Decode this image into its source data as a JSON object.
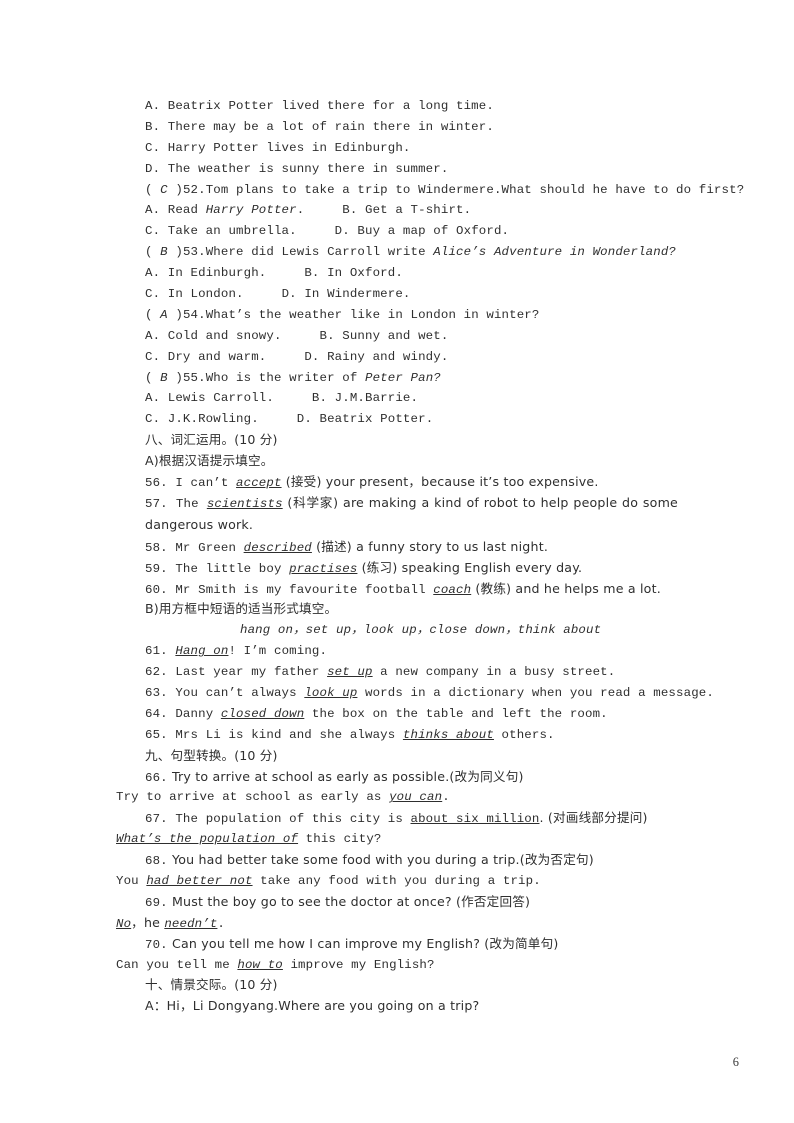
{
  "document": {
    "type": "english-exam-worksheet",
    "page_number": "6",
    "text_color": "#2e2e2e",
    "background": "#ffffff"
  },
  "reading_section": {
    "q51_options": [
      "A. Beatrix Potter lived there for a long time.",
      "B. There may be a lot of rain there in winter.",
      "C. Harry Potter lives in Edinburgh.",
      "D. The weather is sunny there in summer."
    ],
    "questions": [
      {
        "answer": "C",
        "number": "52.",
        "stem": "Tom plans to take a trip to Windermere.What should he have to do first?",
        "options_line1_a": "A. Read ",
        "options_line1_a_italic": "Harry Potter",
        "options_line1_a_tail": ".",
        "options_line1_b": "B. Get a T-shirt.",
        "options_line2_c": "C. Take an umbrella.",
        "options_line2_d": "D. Buy a map of Oxford."
      },
      {
        "answer": "B",
        "number": "53.",
        "stem_plain": "Where did Lewis Carroll write ",
        "stem_italic": "Alice’s Adventure in Wonderland?",
        "options_line1_a": "A. In Edinburgh.",
        "options_line1_b": "B. In Oxford.",
        "options_line2_c": "C. In London.",
        "options_line2_d": "D. In Windermere."
      },
      {
        "answer": "A",
        "number": "54.",
        "stem": "What’s the weather like in London in winter?",
        "options_line1_a": "A. Cold and snowy.",
        "options_line1_b": "B. Sunny and wet.",
        "options_line2_c": "C. Dry and warm.",
        "options_line2_d": "D. Rainy and windy."
      },
      {
        "answer": "B",
        "number": "55.",
        "stem_plain": "Who is the writer of ",
        "stem_italic": "Peter Pan?",
        "options_line1_a": "A. Lewis Carroll.",
        "options_line1_b": "B. J.M.Barrie.",
        "options_line2_c": "C. J.K.Rowling.",
        "options_line2_d": "D. Beatrix Potter."
      }
    ]
  },
  "section_eight": {
    "heading": "八、词汇运用。(10 分)",
    "part_a_heading": "A)根据汉语提示填空。",
    "items": [
      {
        "number": "56.",
        "before": " I can’t ",
        "answer": "accept",
        "after": " (接受) your present，because it’s too expensive."
      },
      {
        "number": "57.",
        "before": " The ",
        "answer": "scientists",
        "after": " (科学家) are making a kind of robot to help people do some dangerous work."
      },
      {
        "number": "58.",
        "before": " Mr Green ",
        "answer": "described",
        "after": " (描述) a funny story to us last night."
      },
      {
        "number": "59.",
        "before": " The little boy ",
        "answer": "practises",
        "after": " (练习) speaking English every day."
      },
      {
        "number": "60.",
        "before": " Mr Smith is my favourite football ",
        "answer": "coach",
        "after": " (教练) and he helps me a lot."
      }
    ],
    "part_b_heading": "B)用方框中短语的适当形式填空。",
    "phrase_box": "hang on，set up，look up，close down，think about",
    "phrase_items": [
      {
        "number": "61.",
        "before": " ",
        "answer": "Hang on",
        "after": "! I’m coming."
      },
      {
        "number": "62.",
        "before": " Last year my father ",
        "answer": "set up",
        "after": " a new company in a busy street."
      },
      {
        "number": "63.",
        "before": " You can’t always ",
        "answer": "look up",
        "after": " words in a dictionary when you read a message."
      },
      {
        "number": "64.",
        "before": " Danny ",
        "answer": "closed down",
        "after": " the box on the table and left the room."
      },
      {
        "number": "65.",
        "before": " Mrs Li is kind and she always ",
        "answer": "thinks about",
        "after": " others."
      }
    ]
  },
  "section_nine": {
    "heading": "九、句型转换。(10 分)",
    "items": [
      {
        "number": "66.",
        "prompt": " Try to arrive at school as early as possible.(改为同义句)",
        "answer_before": "Try to arrive at school as early as ",
        "answer": "you can",
        "answer_after": "."
      },
      {
        "number": "67.",
        "prompt_before": " The population of this city is ",
        "prompt_underline": "about six million",
        "prompt_after": ". (对画线部分提问)",
        "answer_before": "",
        "answer": "What’s the population of",
        "answer_after": " this city?"
      },
      {
        "number": "68.",
        "prompt": " You had better take some food with you during a trip.(改为否定句)",
        "answer_before": "You ",
        "answer": "had better not",
        "answer_after": " take any food with you during a trip."
      },
      {
        "number": "69.",
        "prompt": " Must the boy go to see the doctor at once? (作否定回答)",
        "answer_before": "",
        "answer": "No",
        "answer_mid": "，he ",
        "answer2": "needn’t",
        "answer_after": "."
      },
      {
        "number": "70.",
        "prompt": " Can you tell me how I can improve my English? (改为简单句)",
        "answer_before": "Can you tell me ",
        "answer": "how to",
        "answer_after": " improve my English?"
      }
    ]
  },
  "section_ten": {
    "heading": "十、情景交际。(10 分)",
    "dialogue_line": "A：Hi，Li Dongyang.Where are you going on a trip?"
  }
}
